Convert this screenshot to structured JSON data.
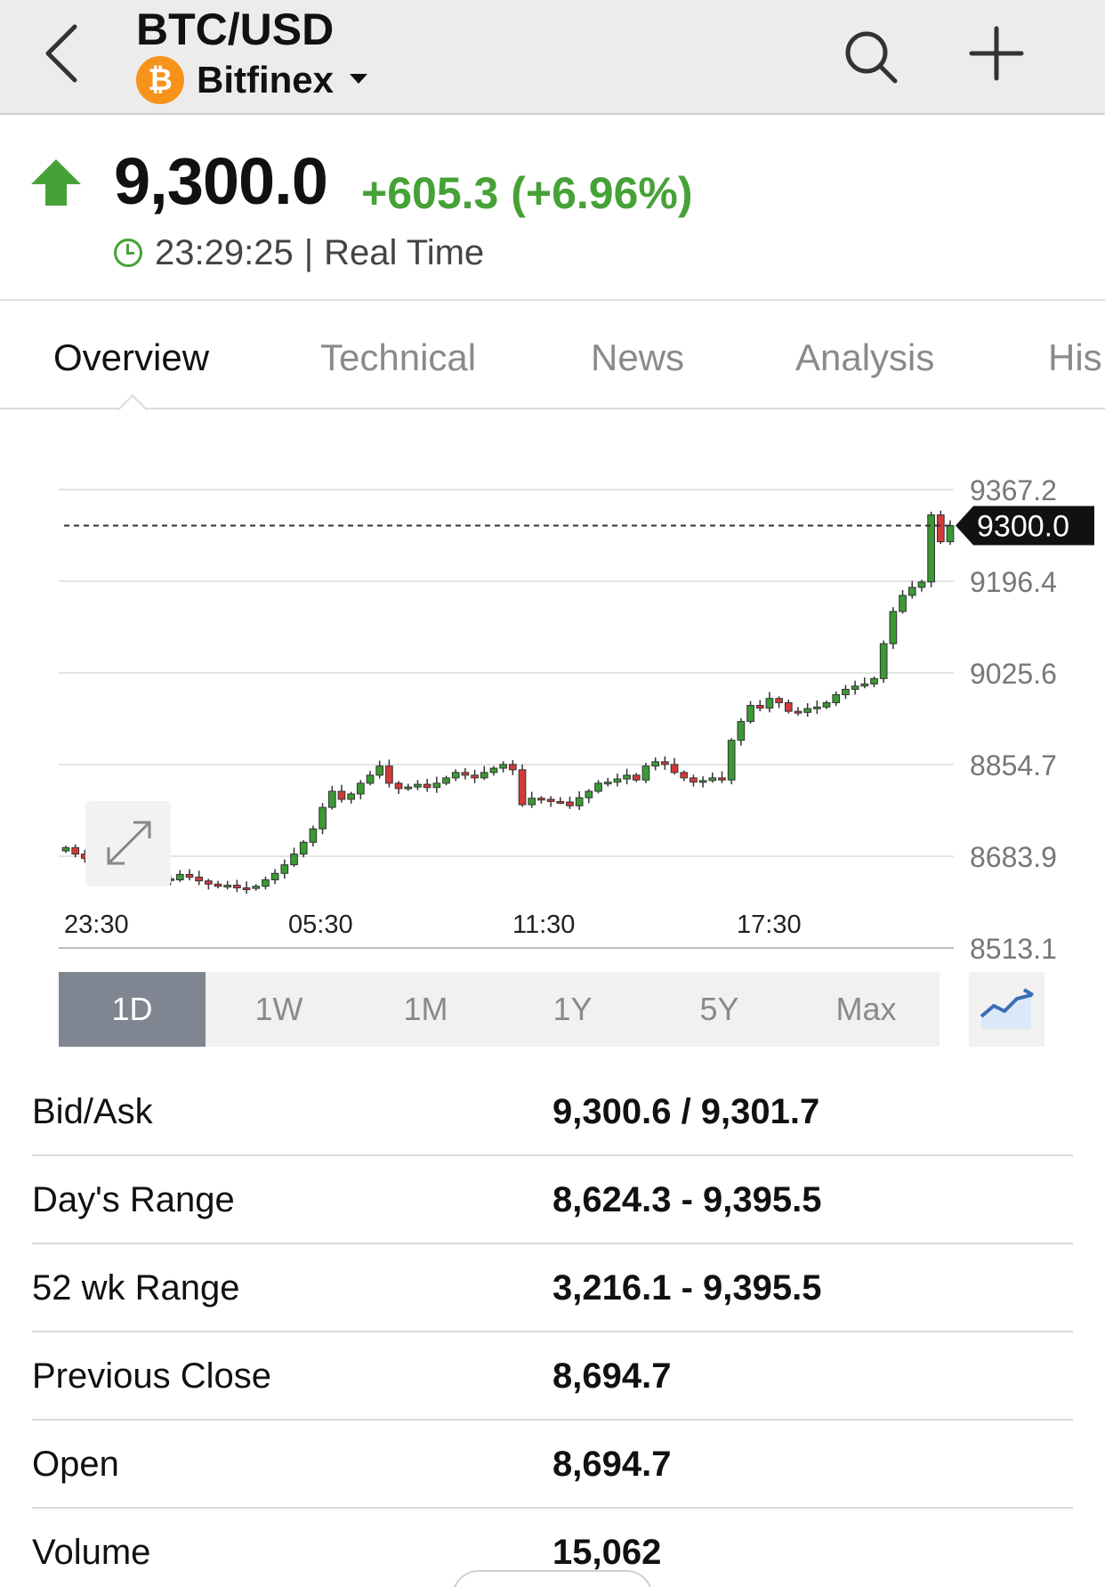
{
  "header": {
    "pair": "BTC/USD",
    "coin_symbol": "₿",
    "exchange": "Bitfinex"
  },
  "quote": {
    "last": "9,300.0",
    "change": "+605.3 (+6.96%)",
    "time": "23:29:25",
    "separator": "|",
    "mode": "Real Time",
    "up_color": "#46a237"
  },
  "tabs": [
    {
      "label": "Overview",
      "active": true
    },
    {
      "label": "Technical",
      "active": false
    },
    {
      "label": "News",
      "active": false
    },
    {
      "label": "Analysis",
      "active": false
    },
    {
      "label": "His",
      "active": false
    }
  ],
  "chart_data": {
    "type": "candlestick",
    "y_tick_labels": [
      "9367.2",
      "9196.4",
      "9025.6",
      "8854.7",
      "8683.9",
      "8513.1"
    ],
    "ylim": [
      8513.1,
      9367.2
    ],
    "x_tick_labels": [
      "23:30",
      "05:30",
      "11:30",
      "17:30"
    ],
    "current_price_label": "9300.0",
    "current_price": 9300.0,
    "up_color": "#3b9a33",
    "down_color": "#d23a3a",
    "closes": [
      8700,
      8688,
      8680,
      8665,
      8650,
      8645,
      8652,
      8648,
      8653,
      8647,
      8642,
      8640,
      8650,
      8645,
      8638,
      8632,
      8628,
      8630,
      8625,
      8624,
      8628,
      8640,
      8652,
      8668,
      8688,
      8710,
      8735,
      8775,
      8805,
      8790,
      8800,
      8820,
      8835,
      8852,
      8820,
      8810,
      8813,
      8818,
      8812,
      8820,
      8830,
      8840,
      8835,
      8830,
      8840,
      8848,
      8855,
      8845,
      8780,
      8792,
      8790,
      8786,
      8785,
      8778,
      8793,
      8805,
      8820,
      8822,
      8828,
      8835,
      8826,
      8852,
      8860,
      8855,
      8840,
      8830,
      8822,
      8825,
      8830,
      8826,
      8900,
      8935,
      8965,
      8960,
      8978,
      8970,
      8954,
      8952,
      8959,
      8962,
      8970,
      8985,
      8995,
      9001,
      9005,
      9015,
      9080,
      9140,
      9170,
      9185,
      9195,
      9320,
      9270,
      9300
    ]
  },
  "periods": [
    {
      "label": "1D",
      "active": true
    },
    {
      "label": "1W",
      "active": false
    },
    {
      "label": "1M",
      "active": false
    },
    {
      "label": "1Y",
      "active": false
    },
    {
      "label": "5Y",
      "active": false
    },
    {
      "label": "Max",
      "active": false
    }
  ],
  "stats": [
    {
      "label": "Bid/Ask",
      "value": "9,300.6 / 9,301.7"
    },
    {
      "label": "Day's Range",
      "value": "8,624.3 - 9,395.5"
    },
    {
      "label": "52 wk Range",
      "value": "3,216.1 - 9,395.5"
    },
    {
      "label": "Previous Close",
      "value": "8,694.7"
    },
    {
      "label": "Open",
      "value": "8,694.7"
    },
    {
      "label": "Volume",
      "value": "15,062"
    }
  ]
}
